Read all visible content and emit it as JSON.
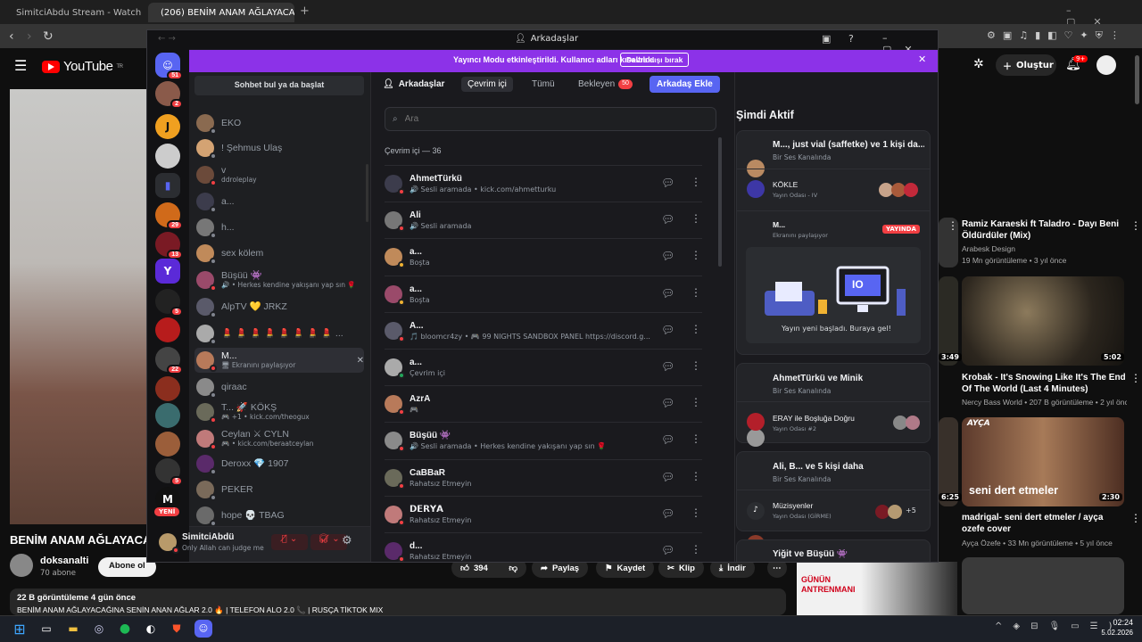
{
  "browser": {
    "tabs": [
      "SimitciAbdu Stream - Watch Live on",
      "(206) BENİM ANAM AĞLAYACAĞ"
    ],
    "new_tab": "+"
  },
  "youtube": {
    "logo": "YouTube",
    "logo_sup": "TR",
    "create_label": "Oluştur",
    "notif_count": "9+",
    "video_title": "BENİM ANAM AĞLAYACA",
    "channel": "doksanalti",
    "subscribers": "70 abone",
    "subscribe_label": "Abone ol",
    "likes": "394",
    "share_label": "Paylaş",
    "save_label": "Kaydet",
    "clip_label": "Klip",
    "download_label": "İndir",
    "views_line": "22 B görüntüleme  4 gün önce",
    "desc_line": "BENİM ANAM AĞLAYACAĞINA SENİN ANAN AĞLAR 2.0 🔥 | TELEFON ALO 2.0 📞 | RUSÇA TİKTOK MIX",
    "recommended": [
      {
        "title": "Ramiz Karaeski ft Taladro - Dayı Beni Öldürdüler (Mix)",
        "channel": "Arabesk Design",
        "meta": "19 Mn görüntüleme • 3 yıl önce",
        "duration": ""
      },
      {
        "title": "Krobak - It's Snowing Like It's The End Of The World (Last 4 Minutes)",
        "channel": "Nercy Bass World",
        "meta": "207 B görüntüleme • 2 yıl önce",
        "duration": "5:02"
      },
      {
        "title": "madrigal- seni dert etmeler / ayça ozefe cover",
        "channel": "Ayça Özefe",
        "meta": "33 Mn görüntüleme • 5 yıl önce",
        "duration": "2:30"
      }
    ],
    "left_durations": [
      "3:49",
      "6:25"
    ],
    "thumb_text": "seni dert etmeler",
    "thumb_brand": "AYÇA",
    "ad_text": "GÜNÜN ANTRENMANI"
  },
  "taskbar": {
    "time": "02:24",
    "date": "5.02.2026"
  },
  "discord": {
    "window_title": "Arkadaşlar",
    "banner_text": "Yayıncı Modu etkinleştirildi. Kullanıcı adları kısaltıldı.",
    "banner_button": "Devre dışı bırak",
    "guild_badges": [
      "51",
      "2",
      "29",
      "13",
      "5",
      "5",
      "22",
      "5"
    ],
    "guild_new": "YENİ",
    "search_conv": "Sohbet bul ya da başlat",
    "dms": [
      {
        "name": "EKO",
        "sub": "",
        "status": "off"
      },
      {
        "name": "! Şehmus Ulaş",
        "sub": "",
        "status": "off"
      },
      {
        "name": "v",
        "sub": "ddroleplay",
        "status": "dnd"
      },
      {
        "name": "a...",
        "sub": "",
        "status": "off"
      },
      {
        "name": "h...",
        "sub": "",
        "status": "off"
      },
      {
        "name": "sex kölem",
        "sub": "",
        "status": "off"
      },
      {
        "name": "Büşüü 👾",
        "sub": "🔊 • Herkes kendine yakışanı yap sın 🌹",
        "status": "dnd"
      },
      {
        "name": "AlpTV 💛 JRKZ",
        "sub": "",
        "status": "off"
      },
      {
        "name": "💄 💄 💄 💄 💄 💄 💄 💄 ...",
        "sub": "",
        "status": "off"
      },
      {
        "name": "M...",
        "sub": "🖥 Ekranını paylaşıyor",
        "status": "dnd"
      },
      {
        "name": "qiraac",
        "sub": "",
        "status": "off"
      },
      {
        "name": "T... 🚀 KÖKŞ",
        "sub": "🎮 +1 • kick.com/theogux",
        "status": "dnd"
      },
      {
        "name": "Ceylan ⚔ CYLN",
        "sub": "🎮 • kick.com/beraatceylan",
        "status": "dnd"
      },
      {
        "name": "Deroxx 💎 1907",
        "sub": "",
        "status": "off"
      },
      {
        "name": "PEKER",
        "sub": "",
        "status": "off"
      },
      {
        "name": "hope 💀 TBAG",
        "sub": "",
        "status": "off"
      }
    ],
    "user": {
      "name": "SimitciAbdü",
      "status": "Only Allah can judge me"
    },
    "tabs": {
      "friends": "Arkadaşlar",
      "online": "Çevrim içi",
      "all": "Tümü",
      "pending": "Bekleyen",
      "pending_count": "50",
      "add": "Arkadaş Ekle"
    },
    "search_placeholder": "Ara",
    "online_header": "Çevrim içi — 36",
    "friends": [
      {
        "name": "AhmetTürkü",
        "sub": "🔊 Sesli aramada • kick.com/ahmetturku",
        "status": "dnd"
      },
      {
        "name": "Ali",
        "sub": "🔊 Sesli aramada",
        "status": "dnd"
      },
      {
        "name": "a...",
        "sub": "Boşta",
        "status": "idle"
      },
      {
        "name": "a...",
        "sub": "Boşta",
        "status": "idle"
      },
      {
        "name": "A...",
        "sub": "🎵 bloomcr4zy • 🎮 99 NIGHTS SANDBOX PANEL https://discord.g...",
        "status": "dnd"
      },
      {
        "name": "a...",
        "sub": "Çevrim içi",
        "status": "on"
      },
      {
        "name": "AzrA",
        "sub": "🎮",
        "status": "dnd"
      },
      {
        "name": "Büşüü 👾",
        "sub": "🔊 Sesli aramada • Herkes kendine yakışanı yap sın 🌹",
        "status": "dnd"
      },
      {
        "name": "CaBBaR",
        "sub": "Rahatsız Etmeyin",
        "status": "dnd"
      },
      {
        "name": "𝗗𝗘𝗥𝗬𝗔",
        "sub": "Rahatsız Etmeyin",
        "status": "dnd"
      },
      {
        "name": "d...",
        "sub": "Rahatsız Etmeyin",
        "status": "dnd"
      }
    ],
    "active_title": "Şimdi Aktif",
    "active": {
      "c1_title": "M..., just vial (saffetke) ve 1 kişi da...",
      "c1_sub": "Bir Ses Kanalında",
      "c1_room": "KÖKLE",
      "c1_room_sub": "Yayın Odası - IV",
      "c1_live_name": "M...",
      "c1_live_sub": "Ekranını paylaşıyor",
      "live_badge": "YAYINDA",
      "stream_cta": "Yayın yeni başladı. Buraya gel!",
      "stream_screen": "IO",
      "c2_title": "AhmetTürkü ve Minik",
      "c2_sub": "Bir Ses Kanalında",
      "c2_room": "ERAY ile Boşluğa Doğru",
      "c2_room_sub": "Yayın Odası #2",
      "c3_title": "Ali, B... ve 5 kişi daha",
      "c3_sub": "Bir Ses Kanalında",
      "c3_room": "Müzisyenler",
      "c3_room_sub": "Yayın Odası (GİRME)",
      "c3_more": "+5",
      "c4_title": "Yiğit ve Büşüü 👾"
    }
  }
}
